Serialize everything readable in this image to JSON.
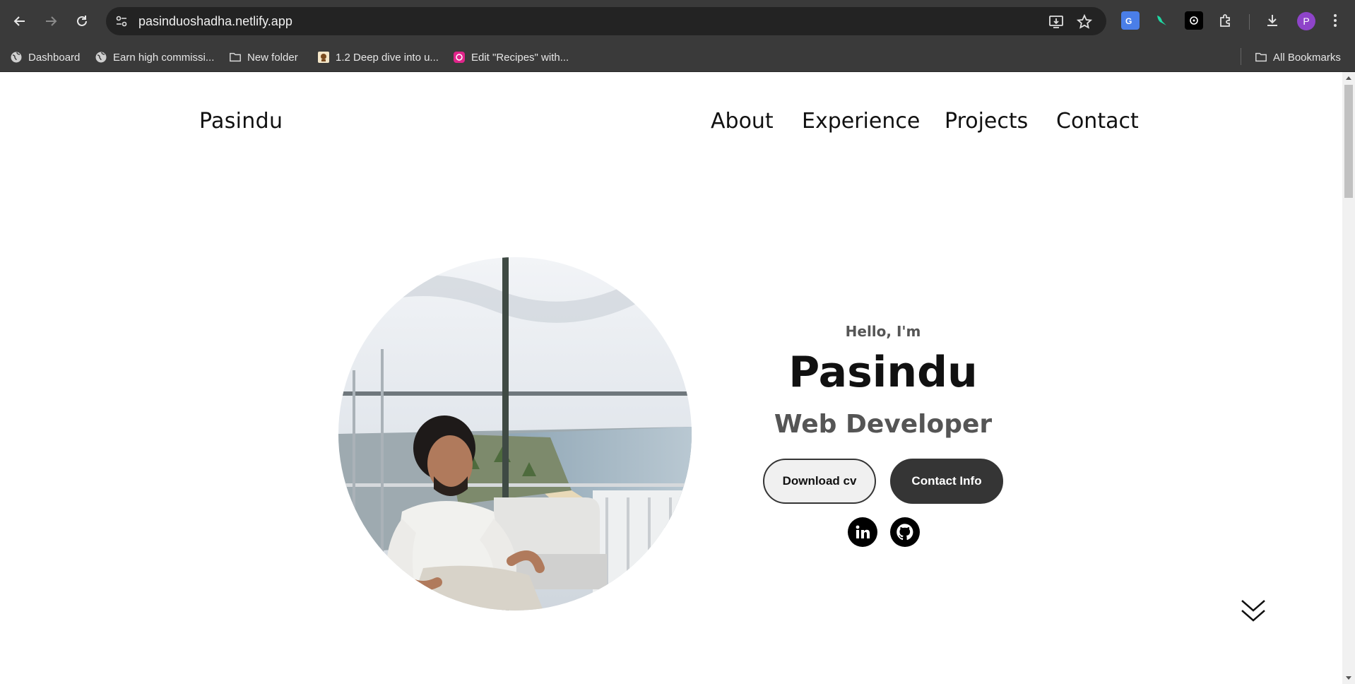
{
  "browser": {
    "url": "pasinduoshadha.netlify.app",
    "profile_initial": "P",
    "bookmarks": [
      {
        "label": "Dashboard",
        "icon": "globe-icon"
      },
      {
        "label": "Earn high commissi...",
        "icon": "globe-icon"
      },
      {
        "label": "New folder",
        "icon": "folder-icon"
      },
      {
        "label": "1.2 Deep dive into u...",
        "icon": "site-favicon"
      },
      {
        "label": "Edit \"Recipes\" with...",
        "icon": "site-favicon"
      }
    ],
    "all_bookmarks_label": "All Bookmarks",
    "colors": {
      "chrome_bg": "#3a3a3a",
      "omnibox_bg": "#232323",
      "profile": "#8e44c9"
    }
  },
  "site": {
    "logo": "Pasindu",
    "nav": [
      "About",
      "Experience",
      "Projects",
      "Contact"
    ]
  },
  "hero": {
    "greeting": "Hello, I'm",
    "name": "Pasindu",
    "role": "Web Developer",
    "download_cv_label": "Download cv",
    "contact_info_label": "Contact Info",
    "social": [
      {
        "name": "linkedin-icon"
      },
      {
        "name": "github-icon"
      }
    ],
    "colors": {
      "button_dark": "#353535",
      "button_light": "#f0f0f0",
      "subtext": "#555555"
    }
  }
}
